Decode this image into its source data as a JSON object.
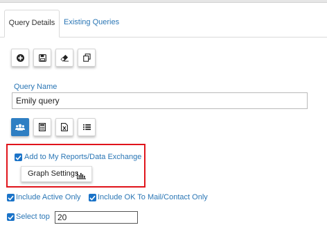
{
  "tabs": [
    {
      "label": "Query Details",
      "active": true
    },
    {
      "label": "Existing Queries",
      "active": false
    }
  ],
  "toolbar": {
    "icons": [
      "plus-circle-icon",
      "save-icon",
      "eraser-icon",
      "copy-icon"
    ]
  },
  "query_name": {
    "label": "Query Name",
    "value": "Emily query"
  },
  "view_toolbar": {
    "icons": [
      "users-icon",
      "calculator-icon",
      "excel-icon",
      "list-icon"
    ],
    "active_index": 0
  },
  "options": {
    "add_to_reports": {
      "label": "Add to My Reports/Data Exchange",
      "checked": true
    },
    "graph_settings_label": "Graph Settings",
    "include_active": {
      "label": "Include Active Only",
      "checked": true
    },
    "include_ok": {
      "label": "Include OK To Mail/Contact Only",
      "checked": true
    },
    "select_top": {
      "label": "Select top",
      "checked": true,
      "value": "20"
    }
  },
  "colors": {
    "accent": "#2a76b5",
    "active_button": "#2f7fc3",
    "checkbox": "#1a73c8",
    "highlight_border": "#e0141b"
  }
}
